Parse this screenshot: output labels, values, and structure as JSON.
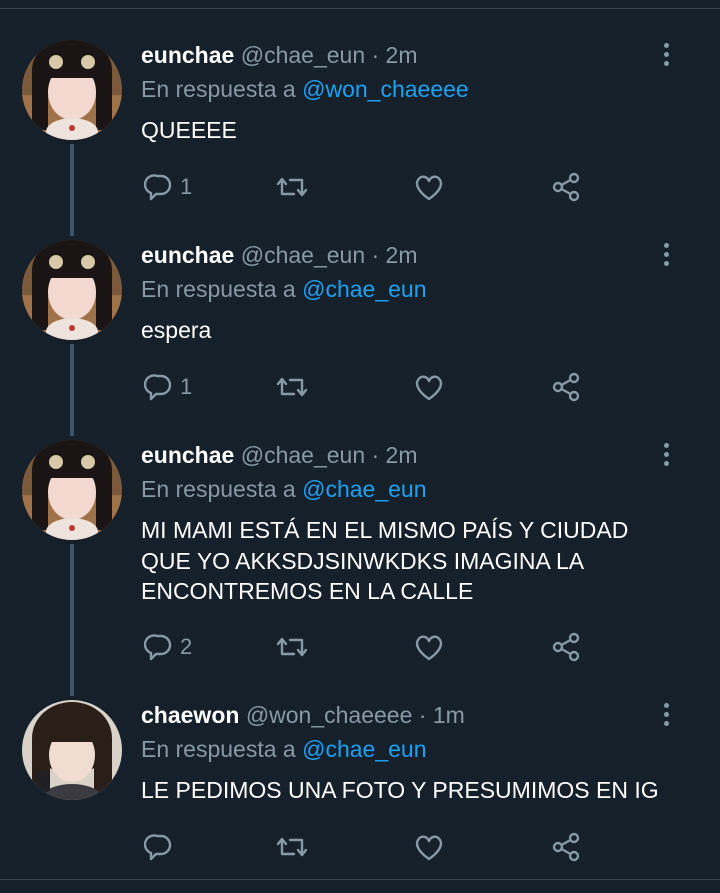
{
  "colors": {
    "background": "#15202b",
    "text_primary": "#ffffff",
    "text_secondary": "#8899a6",
    "mention": "#1da1f2",
    "divider": "#38444d",
    "thread_line": "#3d5466"
  },
  "tweets": [
    {
      "name": "eunchae",
      "handle": "@chae_eun · 2m",
      "reply_prefix": "En respuesta a ",
      "reply_to": "@won_chaeeee",
      "text": "QUEEEE",
      "reply_count": "1",
      "icons": [
        "reply-icon",
        "retweet-icon",
        "like-icon",
        "share-icon",
        "more-icon"
      ]
    },
    {
      "name": "eunchae",
      "handle": "@chae_eun · 2m",
      "reply_prefix": "En respuesta a ",
      "reply_to": "@chae_eun",
      "text": "espera",
      "reply_count": "1",
      "icons": [
        "reply-icon",
        "retweet-icon",
        "like-icon",
        "share-icon",
        "more-icon"
      ]
    },
    {
      "name": "eunchae",
      "handle": "@chae_eun · 2m",
      "reply_prefix": "En respuesta a ",
      "reply_to": "@chae_eun",
      "text": "MI MAMI ESTÁ EN EL MISMO PAÍS Y CIUDAD QUE YO AKKSDJSINWKDKS IMAGINA LA ENCONTREMOS EN LA CALLE",
      "reply_count": "2",
      "icons": [
        "reply-icon",
        "retweet-icon",
        "like-icon",
        "share-icon",
        "more-icon"
      ]
    },
    {
      "name": "chaewon",
      "handle": "@won_chaeeee · 1m",
      "reply_prefix": "En respuesta a ",
      "reply_to": "@chae_eun",
      "text": "LE PEDIMOS UNA FOTO Y PRESUMIMOS EN IG",
      "reply_count": "",
      "icons": [
        "reply-icon",
        "retweet-icon",
        "like-icon",
        "share-icon",
        "more-icon"
      ]
    }
  ]
}
